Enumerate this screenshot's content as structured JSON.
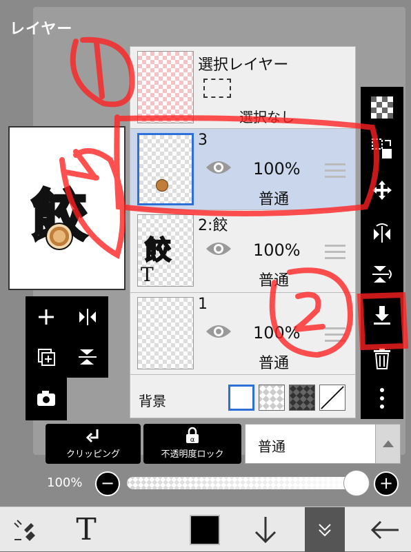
{
  "panel_title": "レイヤー",
  "selection_layer": {
    "title": "選択レイヤー",
    "status": "選択なし"
  },
  "layers": [
    {
      "name": "3",
      "opacity": "100%",
      "blend": "普通",
      "selected": true
    },
    {
      "name": "2:餃",
      "opacity": "100%",
      "blend": "普通",
      "selected": false,
      "type_badge": "T",
      "thumb_glyph": "餃"
    },
    {
      "name": "1",
      "opacity": "100%",
      "blend": "普通",
      "selected": false
    }
  ],
  "background": {
    "label": "背景"
  },
  "preview_glyph": "餃",
  "buttons": {
    "clipping": "クリッピング",
    "opacity_lock": "不透明度ロック",
    "blend_mode": "普通"
  },
  "opacity": {
    "label": "100%",
    "value": 1.0,
    "minus": "−",
    "plus": "+"
  },
  "annotations": {
    "one": "①",
    "two": "②"
  },
  "bottom_bar": {
    "text_tool": "T"
  },
  "colors": {
    "accent": "#2d6fd8",
    "annotation": "#ff2020",
    "selected_row": "#c9d6ec"
  }
}
